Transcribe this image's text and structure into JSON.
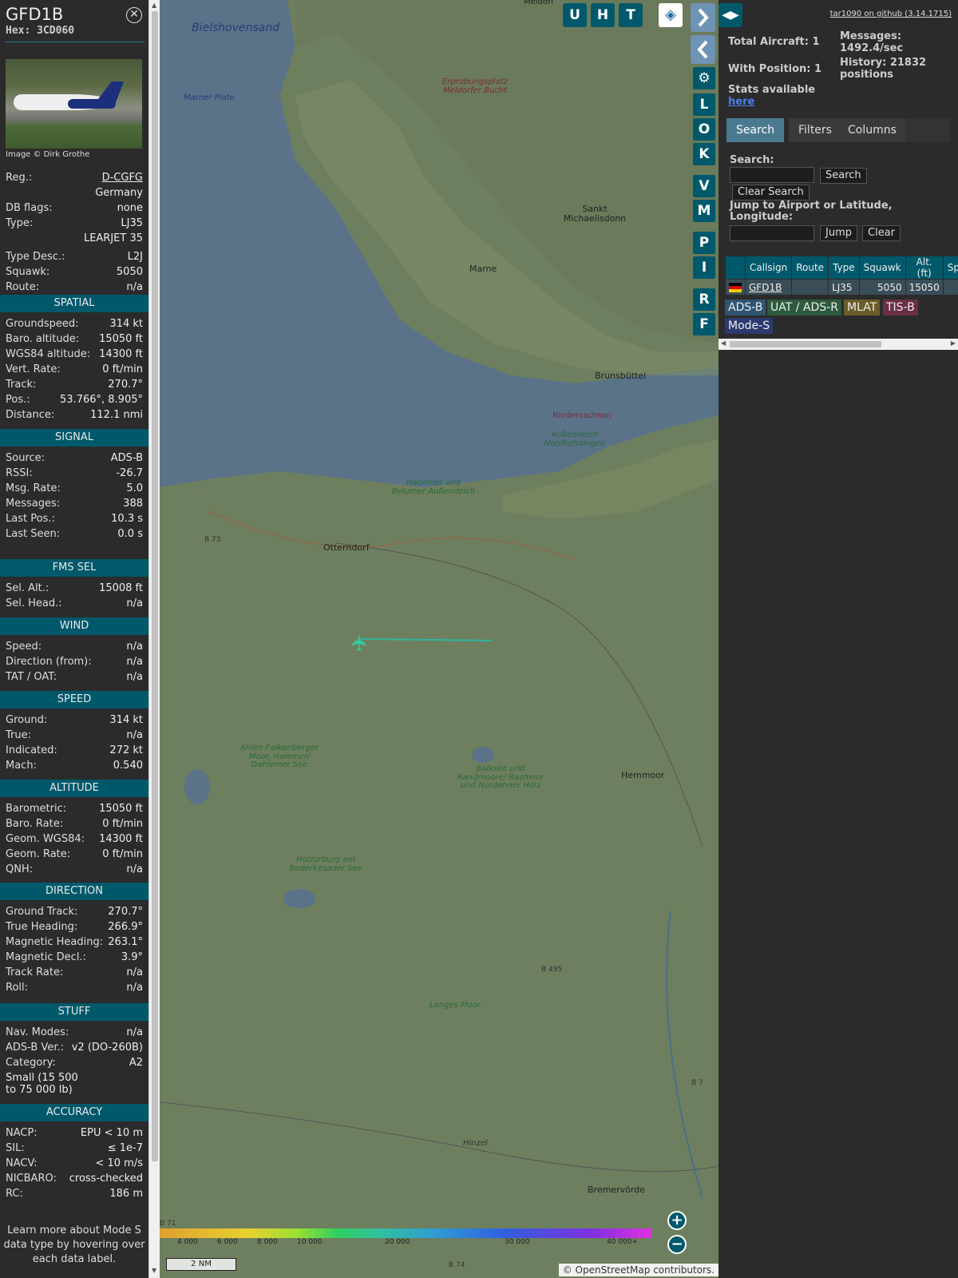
{
  "sidebar": {
    "callsign": "GFD1B",
    "hex": "Hex: 3CD060",
    "close_icon": "close-icon",
    "image_credit": "Image © Dirk Grothe",
    "reg": {
      "label": "Reg.:",
      "value": "D-CGFG"
    },
    "country": "Germany",
    "db_flags": {
      "label": "DB flags:",
      "value": "none"
    },
    "type": {
      "label": "Type:",
      "value": "LJ35"
    },
    "type_name": "LEARJET 35",
    "type_desc": {
      "label": "Type Desc.:",
      "value": "L2J"
    },
    "squawk": {
      "label": "Squawk:",
      "value": "5050"
    },
    "route": {
      "label": "Route:",
      "value": "n/a"
    },
    "sections": {
      "spatial": {
        "title": "SPATIAL",
        "rows": [
          {
            "k": "Groundspeed:",
            "v": "314 kt"
          },
          {
            "k": "Baro. altitude:",
            "v": "15050 ft"
          },
          {
            "k": "WGS84 altitude:",
            "v": "14300 ft"
          },
          {
            "k": "Vert. Rate:",
            "v": "0 ft/min"
          },
          {
            "k": "Track:",
            "v": "270.7°"
          },
          {
            "k": "Pos.:",
            "v": "53.766°, 8.905°"
          },
          {
            "k": "Distance:",
            "v": "112.1 nmi"
          }
        ]
      },
      "signal": {
        "title": "SIGNAL",
        "rows": [
          {
            "k": "Source:",
            "v": "ADS-B"
          },
          {
            "k": "RSSI:",
            "v": "-26.7"
          },
          {
            "k": "Msg. Rate:",
            "v": "5.0"
          },
          {
            "k": "Messages:",
            "v": "388"
          },
          {
            "k": "Last Pos.:",
            "v": "10.3 s"
          },
          {
            "k": "Last Seen:",
            "v": "0.0 s"
          }
        ]
      },
      "fms": {
        "title": "FMS SEL",
        "rows": [
          {
            "k": "Sel. Alt.:",
            "v": "15008 ft"
          },
          {
            "k": "Sel. Head.:",
            "v": "n/a"
          }
        ]
      },
      "wind": {
        "title": "WIND",
        "rows": [
          {
            "k": "Speed:",
            "v": "n/a"
          },
          {
            "k": "Direction (from):",
            "v": "n/a"
          },
          {
            "k": "TAT / OAT:",
            "v": "n/a"
          }
        ]
      },
      "speed": {
        "title": "SPEED",
        "rows": [
          {
            "k": "Ground:",
            "v": "314 kt"
          },
          {
            "k": "True:",
            "v": "n/a"
          },
          {
            "k": "Indicated:",
            "v": "272 kt"
          },
          {
            "k": "Mach:",
            "v": "0.540"
          }
        ]
      },
      "altitude": {
        "title": "ALTITUDE",
        "rows": [
          {
            "k": "Barometric:",
            "v": "15050 ft"
          },
          {
            "k": "Baro. Rate:",
            "v": "0 ft/min"
          },
          {
            "k": "Geom. WGS84:",
            "v": "14300 ft"
          },
          {
            "k": "Geom. Rate:",
            "v": "0 ft/min"
          },
          {
            "k": "QNH:",
            "v": "n/a"
          }
        ]
      },
      "direction": {
        "title": "DIRECTION",
        "rows": [
          {
            "k": "Ground Track:",
            "v": "270.7°"
          },
          {
            "k": "True Heading:",
            "v": "266.9°"
          },
          {
            "k": "Magnetic Heading:",
            "v": "263.1°"
          },
          {
            "k": "Magnetic Decl.:",
            "v": "3.9°"
          },
          {
            "k": "Track Rate:",
            "v": "n/a"
          },
          {
            "k": "Roll:",
            "v": "n/a"
          }
        ]
      },
      "stuff": {
        "title": "STUFF",
        "rows": [
          {
            "k": "Nav. Modes:",
            "v": "n/a"
          },
          {
            "k": "ADS-B Ver.:",
            "v": "v2 (DO-260B)"
          },
          {
            "k": "Category:",
            "v": "A2"
          }
        ],
        "category_desc": "Small (15 500 to 75 000 lb)"
      },
      "accuracy": {
        "title": "ACCURACY",
        "rows": [
          {
            "k": "NACP:",
            "v": "EPU < 10 m"
          },
          {
            "k": "SIL:",
            "v": "≤ 1e-7"
          },
          {
            "k": "NACV:",
            "v": "< 10 m/s"
          },
          {
            "k": "NICBARO:",
            "v": "cross-checked"
          },
          {
            "k": "RC:",
            "v": "186 m"
          }
        ]
      }
    },
    "footer": "Learn more about Mode S data type by hovering over each data label."
  },
  "map": {
    "places": [
      "Bielshovensand",
      "Marner Plate",
      "Erprobungsplatz Meldorfer Bucht",
      "Sankt Michaelisdonn",
      "Marne",
      "Brunsbüttel",
      "Niedersachsen",
      "Außendeich Nordkehdingen",
      "Hadelner und Belumer Außendeich",
      "Otterndorf",
      "B 73",
      "Ahlen-Falkenberger Moor, Halemer/ Dahlemer See",
      "Balksee und Randmoore/ Basmoor und Nordahner Holz",
      "Hemmoor",
      "Holzurburg am Bederkesader See",
      "B 495",
      "Langes Moor",
      "Hinzel",
      "Bremervörde",
      "B 71",
      "B 74",
      "Meldorf",
      "B 7"
    ],
    "top_buttons": [
      "U",
      "H",
      "T"
    ],
    "side_buttons": [
      "L",
      "O",
      "K",
      "V",
      "M",
      "P",
      "I",
      "R",
      "F"
    ],
    "layers_icon": "layers-icon",
    "zoom_in": "+",
    "zoom_out": "−",
    "altitude_scale": [
      "4 000",
      "6 000",
      "8 000",
      "10 000",
      "20 000",
      "30 000",
      "40 000+"
    ],
    "scale_bar": "2 NM",
    "attribution_prefix": "© ",
    "attribution_link": "OpenStreetMap",
    "attribution_suffix": " contributors.",
    "aircraft_icon": "aircraft-icon"
  },
  "right": {
    "github": "tar1090 on github (3.14.1715)",
    "total_aircraft": "Total Aircraft: 1",
    "with_position": "With Position: 1",
    "messages": "Messages: 1492.4/sec",
    "history": "History: 21832 positions",
    "stats": "Stats available",
    "stats_link": "here",
    "tabs": [
      "Search",
      "Filters",
      "Columns"
    ],
    "search_label": "Search:",
    "search_btn": "Search",
    "clear_search_btn": "Clear Search",
    "jump_label": "Jump to Airport or Latitude, Longitude:",
    "jump_btn": "Jump",
    "clear_btn": "Clear",
    "table": {
      "headers": [
        "Callsign",
        "Route",
        "Type",
        "Squawk",
        "Alt. (ft)",
        "Spd."
      ],
      "rows": [
        {
          "callsign": "GFD1B",
          "route": "",
          "type": "LJ35",
          "squawk": "5050",
          "alt": "15050",
          "spd": ""
        }
      ]
    },
    "legend": [
      "ADS-B",
      "UAT / ADS-R",
      "MLAT",
      "TIS-B",
      "Mode-S"
    ]
  },
  "colors": {
    "accent": "#00596b",
    "adsb": "#2f5570",
    "uat": "#2e5a3d",
    "mlat": "#6b5c2a",
    "tisb": "#6a2f46",
    "modes": "#2b3b70"
  }
}
